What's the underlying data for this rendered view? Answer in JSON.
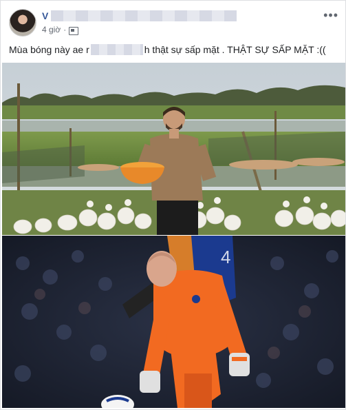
{
  "post": {
    "author_initial": "V",
    "timestamp": "4 giờ",
    "caption_prefix": "Mùa bóng này ae r",
    "caption_suffix": "h thật sự sấp mặt . THẬT SỰ SẤP MẶT :(("
  },
  "icons": {
    "avatar": "avatar",
    "privacy": "friends-privacy-icon",
    "more": "more-options-icon"
  },
  "colors": {
    "link": "#365899",
    "meta": "#616770",
    "keeper_kit": "#f26a21"
  }
}
